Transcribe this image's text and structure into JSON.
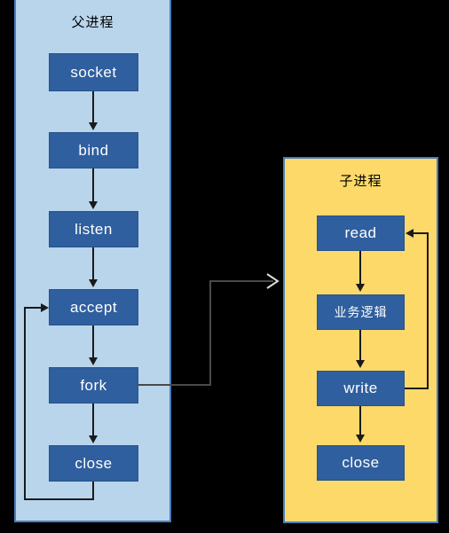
{
  "diagram": {
    "background_color": "#000000",
    "panels": [
      {
        "id": "parent-process",
        "title": "父进程",
        "fill": "#b9d5ec",
        "border": "#4a7ebb",
        "nodes": [
          {
            "id": "socket",
            "label": "socket"
          },
          {
            "id": "bind",
            "label": "bind"
          },
          {
            "id": "listen",
            "label": "listen"
          },
          {
            "id": "accept",
            "label": "accept"
          },
          {
            "id": "fork",
            "label": "fork"
          },
          {
            "id": "close",
            "label": "close"
          }
        ]
      },
      {
        "id": "child-process",
        "title": "子进程",
        "fill": "#fcd969",
        "border": "#4a7ebb",
        "nodes": [
          {
            "id": "read",
            "label": "read"
          },
          {
            "id": "business-logic",
            "label": "业务逻辑"
          },
          {
            "id": "write",
            "label": "write"
          },
          {
            "id": "close",
            "label": "close"
          }
        ]
      }
    ],
    "node_fill": "#2f5f9e",
    "node_text_color": "#ffffff",
    "connector_color": "#1a1a1a",
    "cross_connector_color": "#d9d9d9",
    "edges": [
      {
        "from": "socket",
        "to": "bind"
      },
      {
        "from": "bind",
        "to": "listen"
      },
      {
        "from": "listen",
        "to": "accept"
      },
      {
        "from": "accept",
        "to": "fork"
      },
      {
        "from": "fork",
        "to": "close"
      },
      {
        "from": "close",
        "to": "accept",
        "kind": "loop-back"
      },
      {
        "from": "fork",
        "to": "child-process",
        "kind": "cross-process"
      },
      {
        "from": "read",
        "to": "business-logic"
      },
      {
        "from": "business-logic",
        "to": "write"
      },
      {
        "from": "write",
        "to": "close"
      },
      {
        "from": "write",
        "to": "read",
        "kind": "loop-back"
      }
    ]
  }
}
